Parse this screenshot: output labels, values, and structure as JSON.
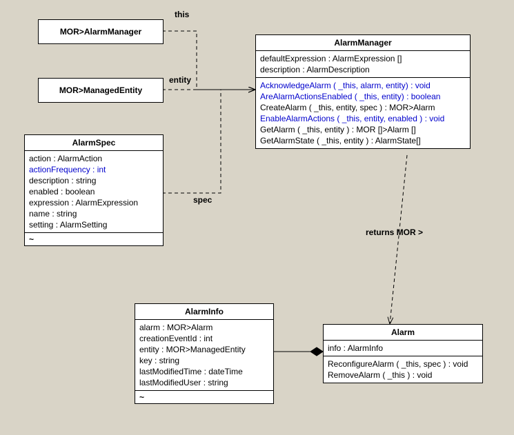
{
  "edge_labels": {
    "this": "this",
    "entity": "entity",
    "spec": "spec",
    "returns_mor": "returns MOR >"
  },
  "mor_alarm_manager": {
    "title": "MOR>AlarmManager"
  },
  "mor_managed_entity": {
    "title": "MOR>ManagedEntity"
  },
  "alarm_spec": {
    "title": "AlarmSpec",
    "attrs": [
      {
        "text": "action : AlarmAction",
        "blue": false
      },
      {
        "text": "actionFrequency : int",
        "blue": true
      },
      {
        "text": "description : string",
        "blue": false
      },
      {
        "text": "enabled : boolean",
        "blue": false
      },
      {
        "text": "expression : AlarmExpression",
        "blue": false
      },
      {
        "text": "name : string",
        "blue": false
      },
      {
        "text": "setting : AlarmSetting",
        "blue": false
      }
    ],
    "tilde": "~"
  },
  "alarm_manager": {
    "title": "AlarmManager",
    "attrs": [
      "defaultExpression : AlarmExpression []",
      "description : AlarmDescription"
    ],
    "ops": [
      {
        "text": "AcknowledgeAlarm ( _this, alarm, entity) : void",
        "blue": true
      },
      {
        "text": "AreAlarmActionsEnabled ( _this, entity) : boolean",
        "blue": true
      },
      {
        "text": "CreateAlarm ( _this, entity, spec ) : MOR>Alarm",
        "blue": false
      },
      {
        "text": "EnableAlarmActions ( _this, entity, enabled ) : void",
        "blue": true
      },
      {
        "text": "GetAlarm ( _this, entity ) : MOR []>Alarm []",
        "blue": false
      },
      {
        "text": "GetAlarmState ( _this, entity ) : AlarmState[]",
        "blue": false
      }
    ]
  },
  "alarm_info": {
    "title": "AlarmInfo",
    "attrs": [
      "alarm : MOR>Alarm",
      "creationEventId : int",
      "entity : MOR>ManagedEntity",
      "key : string",
      "lastModifiedTime : dateTime",
      "lastModifiedUser : string"
    ],
    "tilde": "~"
  },
  "alarm": {
    "title": "Alarm",
    "attrs": [
      "info : AlarmInfo"
    ],
    "ops": [
      "ReconfigureAlarm ( _this, spec ) : void",
      "RemoveAlarm ( _this ) : void"
    ]
  },
  "chart_data": {
    "type": "uml-class",
    "classes": [
      {
        "name": "MOR>AlarmManager"
      },
      {
        "name": "MOR>ManagedEntity"
      },
      {
        "name": "AlarmSpec",
        "attributes": [
          "action : AlarmAction",
          "actionFrequency : int",
          "description : string",
          "enabled : boolean",
          "expression : AlarmExpression",
          "name : string",
          "setting : AlarmSetting"
        ]
      },
      {
        "name": "AlarmManager",
        "attributes": [
          "defaultExpression : AlarmExpression []",
          "description : AlarmDescription"
        ],
        "operations": [
          "AcknowledgeAlarm ( _this, alarm, entity) : void",
          "AreAlarmActionsEnabled ( _this, entity) : boolean",
          "CreateAlarm ( _this, entity, spec ) : MOR>Alarm",
          "EnableAlarmActions ( _this, entity, enabled ) : void",
          "GetAlarm ( _this, entity ) : MOR []>Alarm []",
          "GetAlarmState ( _this, entity ) : AlarmState[]"
        ]
      },
      {
        "name": "AlarmInfo",
        "attributes": [
          "alarm : MOR>Alarm",
          "creationEventId : int",
          "entity : MOR>ManagedEntity",
          "key : string",
          "lastModifiedTime : dateTime",
          "lastModifiedUser : string"
        ]
      },
      {
        "name": "Alarm",
        "attributes": [
          "info : AlarmInfo"
        ],
        "operations": [
          "ReconfigureAlarm ( _this, spec ) : void",
          "RemoveAlarm ( _this ) : void"
        ]
      }
    ],
    "relationships": [
      {
        "from": "MOR>AlarmManager",
        "to": "AlarmManager",
        "type": "dependency",
        "label": "this"
      },
      {
        "from": "MOR>ManagedEntity",
        "to": "AlarmManager",
        "type": "dependency",
        "label": "entity"
      },
      {
        "from": "AlarmSpec",
        "to": "AlarmManager",
        "type": "dependency",
        "label": "spec"
      },
      {
        "from": "AlarmManager",
        "to": "Alarm",
        "type": "dependency",
        "label": "returns MOR >"
      },
      {
        "from": "Alarm",
        "to": "AlarmInfo",
        "type": "composition"
      }
    ]
  }
}
